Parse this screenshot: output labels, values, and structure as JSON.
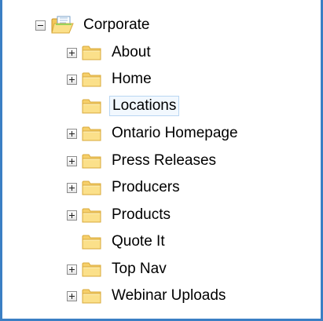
{
  "tree": {
    "root": {
      "label": "Corporate",
      "expanded": true,
      "icon": "open-folder-icon"
    },
    "children": [
      {
        "label": "About",
        "has_children": true,
        "icon": "folder-icon"
      },
      {
        "label": "Home",
        "has_children": true,
        "icon": "folder-icon"
      },
      {
        "label": "Locations",
        "has_children": false,
        "selected": true,
        "icon": "folder-icon"
      },
      {
        "label": "Ontario Homepage",
        "has_children": true,
        "icon": "folder-icon"
      },
      {
        "label": "Press Releases",
        "has_children": true,
        "icon": "folder-icon"
      },
      {
        "label": "Producers",
        "has_children": true,
        "icon": "folder-icon"
      },
      {
        "label": "Products",
        "has_children": true,
        "icon": "folder-icon"
      },
      {
        "label": "Quote It",
        "has_children": false,
        "icon": "folder-icon"
      },
      {
        "label": "Top Nav",
        "has_children": true,
        "icon": "folder-icon"
      },
      {
        "label": "Webinar Uploads",
        "has_children": true,
        "icon": "folder-icon"
      }
    ]
  },
  "colors": {
    "frame_border": "#3b7fc4",
    "folder_fill": "#fbe08a",
    "folder_outline": "#d8a93a",
    "selection_border": "#b9d6f2",
    "selection_fill": "#f2f8fe"
  }
}
